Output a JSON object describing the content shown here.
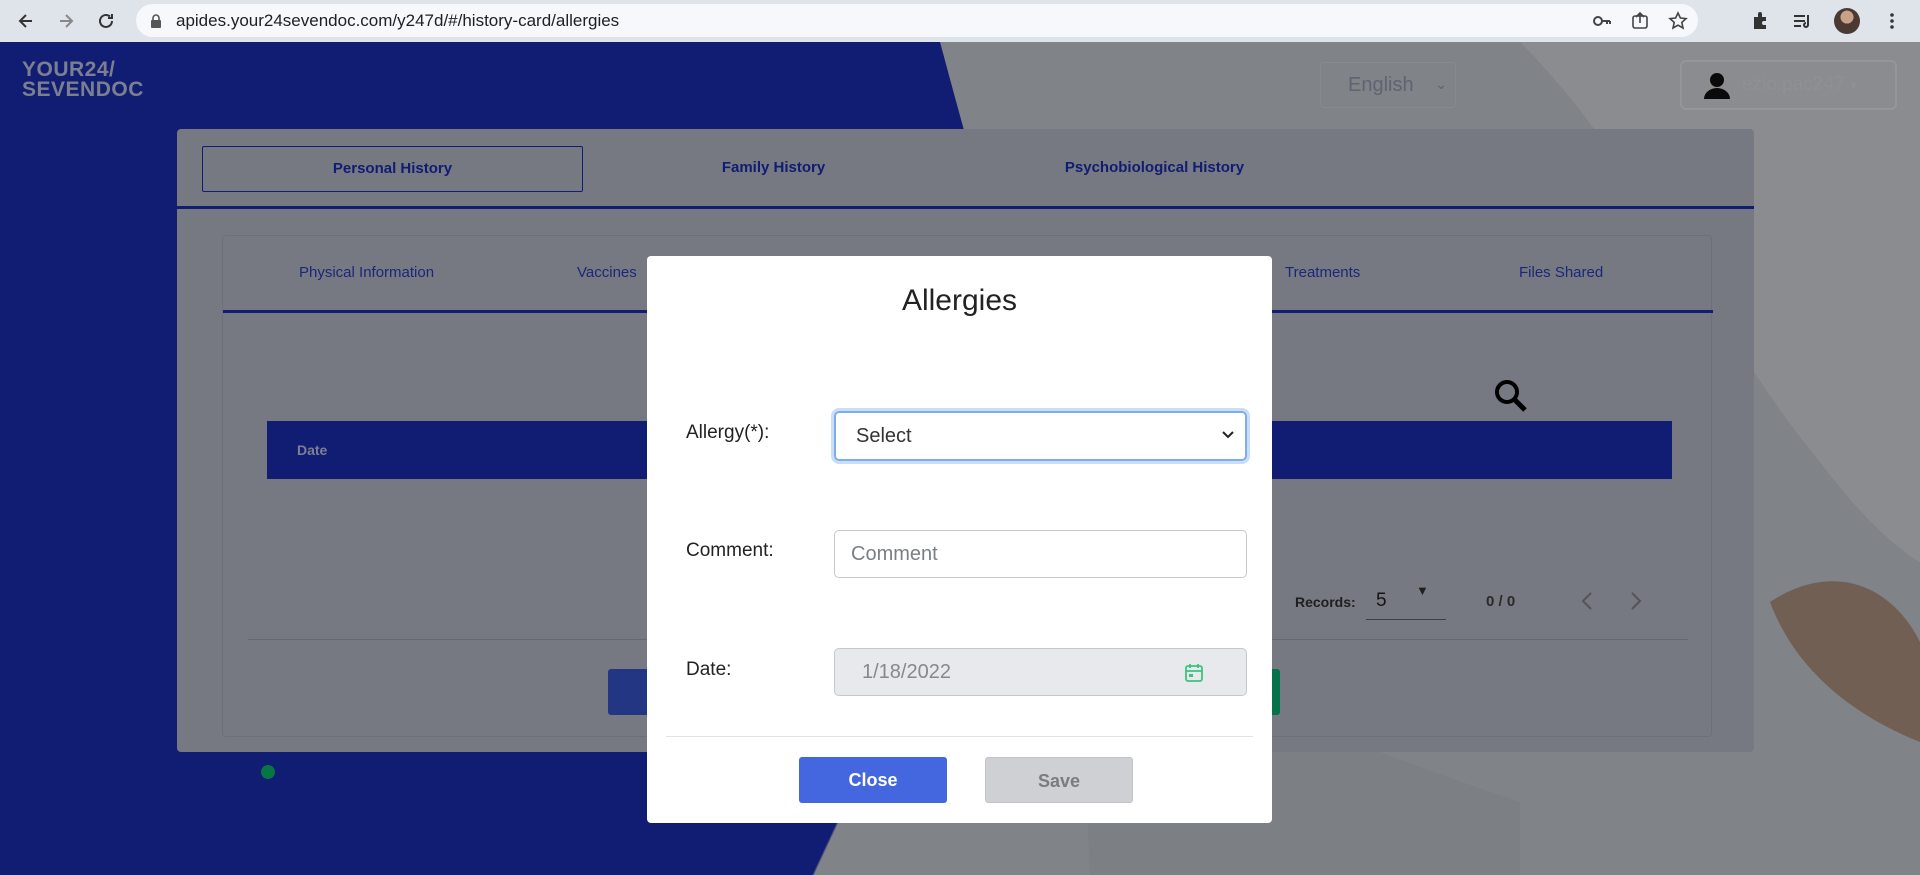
{
  "browser": {
    "url": "apides.your24sevendoc.com/y247d/#/history-card/allergies"
  },
  "header": {
    "logo_line1": "YOUR24/",
    "logo_line2": "SEVENDOC",
    "language": "English",
    "username": "ezio.pac247"
  },
  "main_tabs": [
    "Personal History",
    "Family History",
    "Psychobiological History"
  ],
  "sub_tabs": [
    "Physical Information",
    "Vaccines",
    "Treatments",
    "Files Shared"
  ],
  "table": {
    "columns": [
      "Date"
    ]
  },
  "pagination": {
    "records_label": "Records:",
    "records_value": "5",
    "range": "0 / 0"
  },
  "modal": {
    "title": "Allergies",
    "allergy_label": "Allergy(*):",
    "allergy_value": "Select",
    "comment_label": "Comment:",
    "comment_placeholder": "Comment",
    "date_label": "Date:",
    "date_value": "1/18/2022",
    "close_label": "Close",
    "save_label": "Save"
  }
}
